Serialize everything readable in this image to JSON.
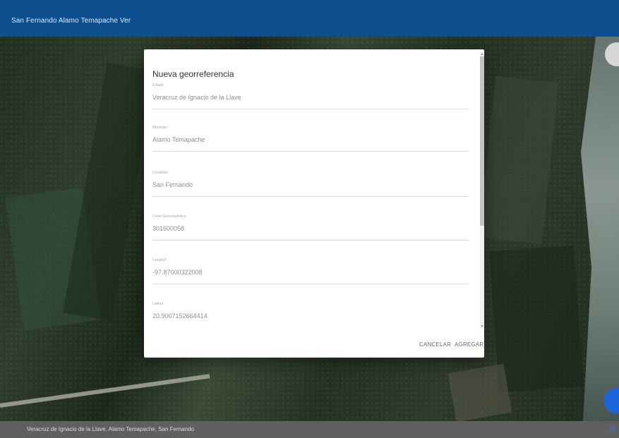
{
  "topbar": {
    "title": "San Fernando Alamo Temapache Ver"
  },
  "dialog": {
    "title": "Nueva georreferencia",
    "fields": [
      {
        "label": "Estado",
        "value": "Veracruz de Ignacio de la Llave"
      },
      {
        "label": "Municipio",
        "value": "Alamo Temapache"
      },
      {
        "label": "Localidad",
        "value": "San Fernando"
      },
      {
        "label": "Clave Geoestadística",
        "value": "301600058"
      },
      {
        "label": "Longitud",
        "value": "-97.87000322008"
      },
      {
        "label": "Latitud",
        "value": "20.9007152664414"
      }
    ],
    "cancel_label": "CANCELAR",
    "add_label": "AGREGAR"
  },
  "bottombar": {
    "location_text": "Veracruz de Ignacio de la Llave, Alamo Temapache, San Fernando"
  },
  "colors": {
    "header": "#0d4f8f",
    "fab_bottom": "#1f63d8",
    "fab_top": "#d6d6d6",
    "footer": "#606060"
  },
  "icons": {
    "top_fab": "circle-button",
    "bottom_fab": "location-button",
    "footer_corner": "globe-icon"
  }
}
